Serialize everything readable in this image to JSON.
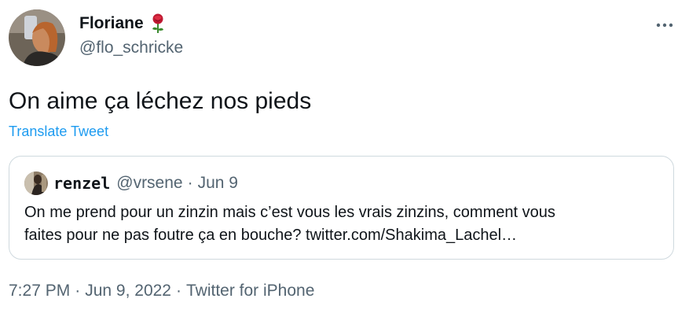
{
  "author": {
    "name": "Floriane",
    "emoji_icon": "rose-icon",
    "handle": "@flo_schricke"
  },
  "tweet": {
    "text": "On aime ça léchez nos pieds",
    "translate_label": "Translate Tweet"
  },
  "quoted": {
    "name": "renzel",
    "handle": "@vrsene",
    "separator": "·",
    "date": "Jun 9",
    "text_lines": [
      "On me prend pour un zinzin mais c’est vous les vrais zinzins, comment vous",
      "faites pour ne pas foutre ça en bouche? twitter.com/Shakima_Lachel…"
    ]
  },
  "meta": {
    "time": "7:27 PM",
    "separator": "·",
    "date": "Jun 9, 2022",
    "source": "Twitter for iPhone"
  },
  "colors": {
    "link": "#1d9bf0",
    "secondary_text": "#536471",
    "border": "#cfd9de"
  }
}
